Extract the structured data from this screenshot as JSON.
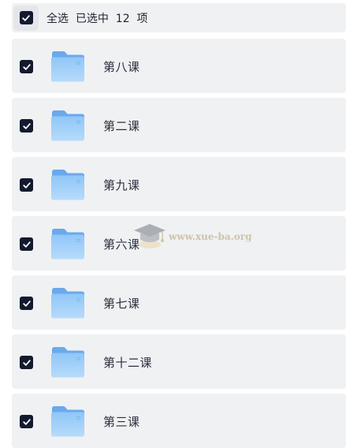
{
  "header": {
    "select_all_label": "全选  已选中  12  项",
    "checked": true
  },
  "folders": [
    {
      "name": "第八课",
      "checked": true
    },
    {
      "name": "第二课",
      "checked": true
    },
    {
      "name": "第九课",
      "checked": true
    },
    {
      "name": "第六课",
      "checked": true
    },
    {
      "name": "第七课",
      "checked": true
    },
    {
      "name": "第十二课",
      "checked": true
    },
    {
      "name": "第三课",
      "checked": true
    }
  ],
  "watermark": {
    "text": "www.xue-ba.org"
  },
  "icons": {
    "checkbox": "checkbox-checked-icon",
    "folder": "folder-icon",
    "watermark_logo": "graduation-cap-icon"
  },
  "colors": {
    "row_background": "#f0f1f3",
    "checkbox_fill": "#141a2e",
    "folder_blue": "#8cc4f6"
  }
}
